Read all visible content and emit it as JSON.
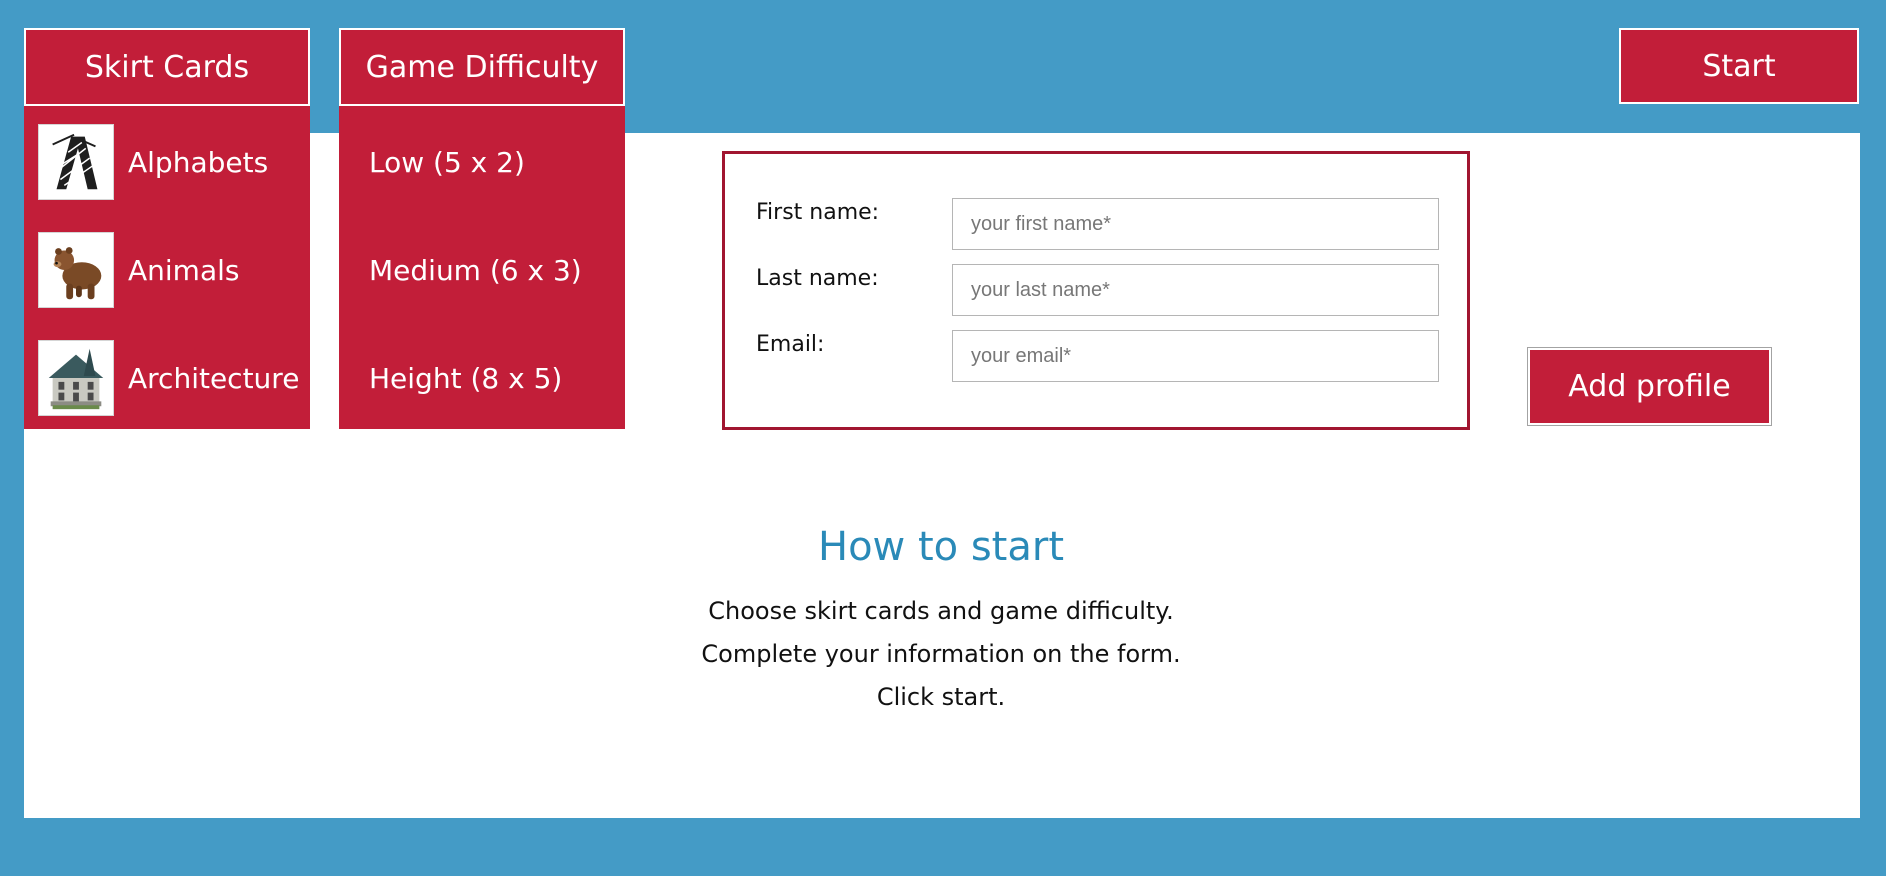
{
  "skirt_menu": {
    "label": "Skirt Cards",
    "items": [
      {
        "label": "Alphabets",
        "icon": "alphabet-a-thumbnail"
      },
      {
        "label": "Animals",
        "icon": "bear-thumbnail"
      },
      {
        "label": "Architecture",
        "icon": "house-thumbnail"
      }
    ]
  },
  "difficulty_menu": {
    "label": "Game Difficulty",
    "items": [
      {
        "label": "Low (5 x 2)"
      },
      {
        "label": "Medium (6 x 3)"
      },
      {
        "label": "Height (8 x 5)"
      }
    ]
  },
  "start_label": "Start",
  "form": {
    "first_name": {
      "label": "First name:",
      "placeholder": "your first name*"
    },
    "last_name": {
      "label": "Last name:",
      "placeholder": "your last name*"
    },
    "email": {
      "label": "Email:",
      "placeholder": "your email*"
    }
  },
  "add_profile_label": "Add profile",
  "how_to": {
    "title": "How to start",
    "lines": [
      "Choose skirt cards and game difficulty.",
      "Complete your information on the form.",
      "Click start."
    ]
  },
  "colors": {
    "background": "#449bc6",
    "accent": "#c21e39",
    "title": "#2a8ab8",
    "form_border": "#a11530"
  }
}
